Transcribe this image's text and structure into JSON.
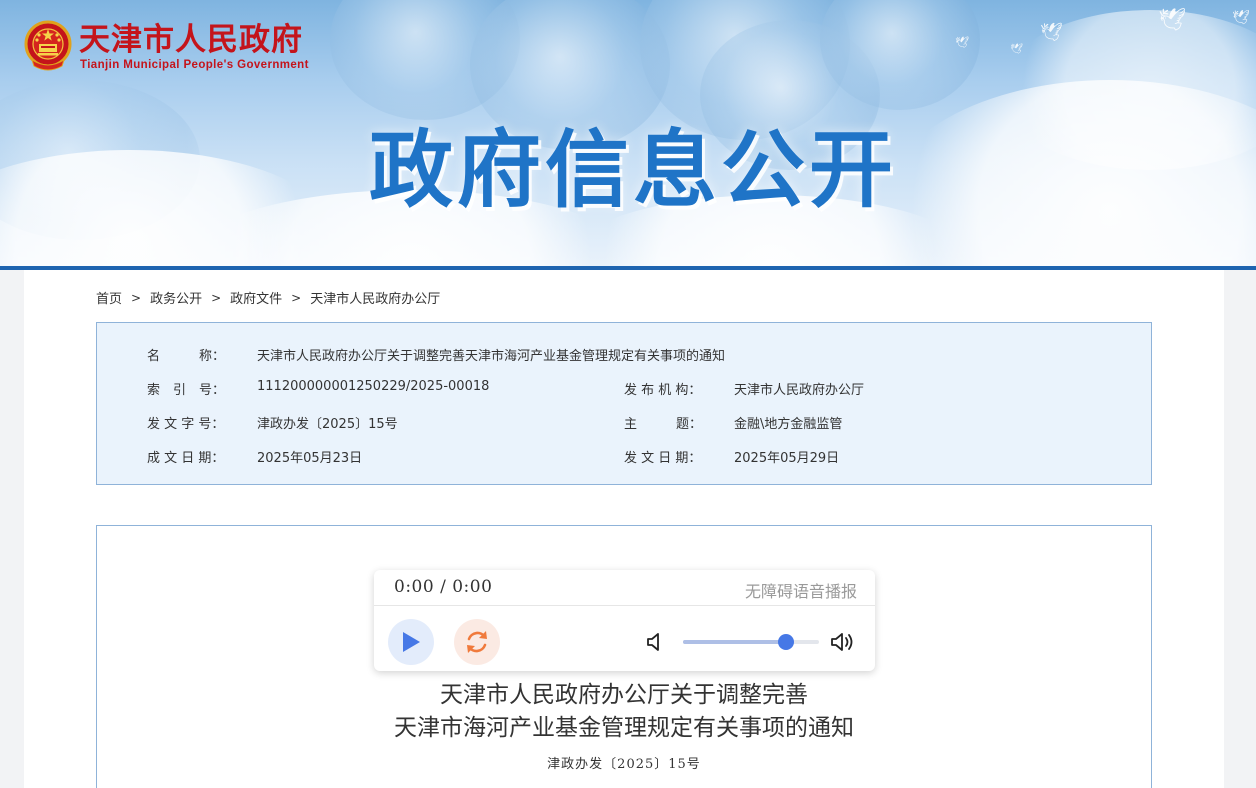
{
  "header": {
    "site_name_cn": "天津市人民政府",
    "site_name_en": "Tianjin Municipal People's Government",
    "banner_title": "政府信息公开"
  },
  "breadcrumb": [
    "首页",
    "政务公开",
    "政府文件",
    "天津市人民政府办公厅"
  ],
  "breadcrumb_separator": ">",
  "info": {
    "name_label": "名　　　称：",
    "name_value": "天津市人民政府办公厅关于调整完善天津市海河产业基金管理规定有关事项的通知",
    "index_label": "索　引　号：",
    "index_value": "111200000001250229/2025-00018",
    "issuer_label": "发 布 机 构：",
    "issuer_value": "天津市人民政府办公厅",
    "docno_label": "发 文 字 号：",
    "docno_value": "津政办发〔2025〕15号",
    "topic_label": "主　　　题：",
    "topic_value": "金融\\地方金融监管",
    "created_label": "成 文 日 期：",
    "created_value": "2025年05月23日",
    "published_label": "发 文 日 期：",
    "published_value": "2025年05月29日"
  },
  "player": {
    "time": "0:00 / 0:00",
    "tag": "无障碍语音播报",
    "volume_level": 0.76,
    "play_icon": "play-icon",
    "refresh_icon": "refresh-icon",
    "accent": "#4678e6"
  },
  "document": {
    "title_line1": "天津市人民政府办公厅关于调整完善",
    "title_line2": "天津市海河产业基金管理规定有关事项的通知",
    "number": "津政办发〔2025〕15号"
  },
  "colors": {
    "brand_red": "#c4141b",
    "brand_blue": "#1f74c7",
    "border_blue": "#8fb3d9",
    "info_bg": "#eaf3fc"
  }
}
